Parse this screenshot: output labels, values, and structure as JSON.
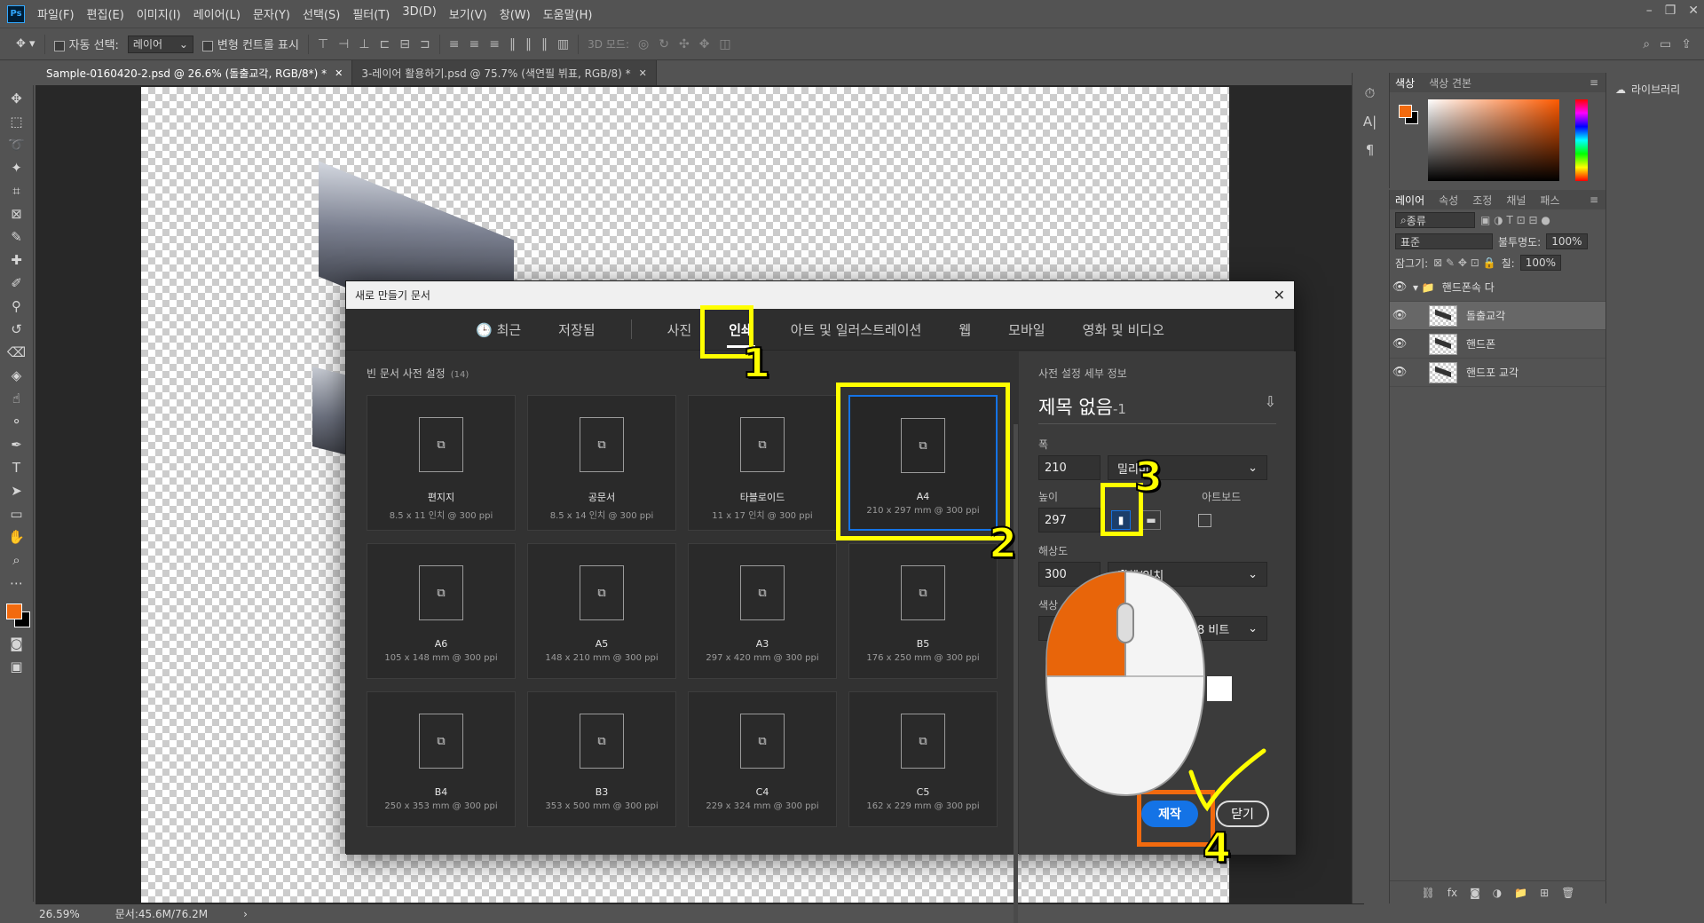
{
  "app": {
    "logo": "Ps",
    "menus": [
      "파일(F)",
      "편집(E)",
      "이미지(I)",
      "레이어(L)",
      "문자(Y)",
      "선택(S)",
      "필터(T)",
      "3D(D)",
      "보기(V)",
      "창(W)",
      "도움말(H)"
    ]
  },
  "options": {
    "auto_select_label": "자동 선택:",
    "auto_select_value": "레이어",
    "transform_label": "변형 컨트롤 표시",
    "mode3d_label": "3D 모드:"
  },
  "tabs": [
    {
      "label": "Sample-0160420-2.psd @ 26.6% (돌출교각, RGB/8*) *"
    },
    {
      "label": "3-레이어 활용하기.psd @ 75.7% (색연필 뷔표, RGB/8) *"
    }
  ],
  "status": {
    "zoom": "26.59%",
    "doc": "문서:45.6M/76.2M"
  },
  "panels": {
    "color_tabs": [
      "색상",
      "색상 견본"
    ],
    "library": "라이브러리",
    "layer_tabs": [
      "레이어",
      "속성",
      "조정",
      "채널",
      "패스"
    ],
    "kind": "종류",
    "blend": "표준",
    "opacity_label": "불투명도:",
    "opacity": "100%",
    "lock_label": "잠그기:",
    "fill_label": "칠:",
    "fill": "100%",
    "layers": [
      {
        "name": "핸드폰속 다",
        "group": true
      },
      {
        "name": "돌출교각",
        "selected": true
      },
      {
        "name": "핸드폰"
      },
      {
        "name": "핸드포 교각"
      }
    ]
  },
  "dialog": {
    "title": "새로 만들기 문서",
    "tabs": [
      "최근",
      "저장됨",
      "사진",
      "인쇄",
      "아트 및 일러스트레이션",
      "웹",
      "모바일",
      "영화 및 비디오"
    ],
    "active_tab": "인쇄",
    "presets_header": "빈 문서 사전 설정",
    "presets_count": "(14)",
    "presets": [
      {
        "name": "편지지",
        "size": "8.5 x 11 인치 @ 300 ppi"
      },
      {
        "name": "공문서",
        "size": "8.5 x 14 인치 @ 300 ppi"
      },
      {
        "name": "타블로이드",
        "size": "11 x 17 인치 @ 300 ppi"
      },
      {
        "name": "A4",
        "size": "210 x 297 mm @ 300 ppi",
        "selected": true
      },
      {
        "name": "A6",
        "size": "105 x 148 mm @ 300 ppi"
      },
      {
        "name": "A5",
        "size": "148 x 210 mm @ 300 ppi"
      },
      {
        "name": "A3",
        "size": "297 x 420 mm @ 300 ppi"
      },
      {
        "name": "B5",
        "size": "176 x 250 mm @ 300 ppi"
      },
      {
        "name": "B4",
        "size": "250 x 353 mm @ 300 ppi"
      },
      {
        "name": "B3",
        "size": "353 x 500 mm @ 300 ppi"
      },
      {
        "name": "C4",
        "size": "229 x 324 mm @ 300 ppi"
      },
      {
        "name": "C5",
        "size": "162 x 229 mm @ 300 ppi"
      }
    ],
    "details": {
      "header": "사전 설정 세부 정보",
      "doc_title": "제목 없음",
      "doc_suffix": "-1",
      "width_label": "폭",
      "width": "210",
      "unit": "밀리미터",
      "height_label": "높이",
      "height": "297",
      "artboard_label": "아트보드",
      "resolution_label": "해상도",
      "resolution": "300",
      "res_unit": "픽셀/인치",
      "color_label": "색상",
      "bit_depth": "8 비트",
      "make_button": "제작",
      "close_button": "닫기"
    }
  },
  "annotations": [
    "1",
    "2",
    "3",
    "4"
  ],
  "colors": {
    "accent": "#1473e6",
    "highlight": "#ffff00",
    "annotation_box": "#f26a0e",
    "foreground": "#f26a0e"
  }
}
